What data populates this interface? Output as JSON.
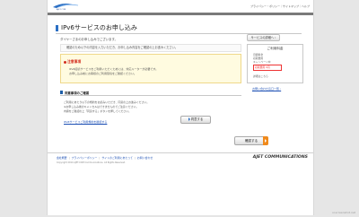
{
  "header": {
    "logo_text": "AJET.COM",
    "nav": "プライバシー・ポリシー｜サイトマップ｜ヘルプ"
  },
  "main": {
    "title": "IPv6サービスのお申し込み",
    "lead": "ダイヤーさまのお申し込みでございます。",
    "notice": "確認のため以下の内容を入力いただき、お申し込み内容をご確認の上お進みください。",
    "close_button": "サービスの詳細へ ›",
    "warning": {
      "title": "注意事項",
      "line1": "IPv6接続サービスをご利用いただくためには、対応ルーターが必要です。",
      "line2": "お申し込み前にお客様のご利用環境をご確認ください。"
    },
    "section_title": "同意事項のご確認",
    "consent_lines": [
      "ご利用にあたり以下の規約をお読みいただき、同意の上お進みください。",
      "※お申し込み後のキャンセルはできませんのでご注意ください。",
      "内容をご確認の上「同意する」ボタンを押してください。"
    ],
    "terms_link": "IPv6サービスご利用規約を確認する",
    "agree_button": "同意する",
    "confirm_button": "確認する"
  },
  "contact": {
    "title": "ご利用料金",
    "line1": "月額料金",
    "line2": "初期費用",
    "line3": "キャンペーン中",
    "highlight": "初期費用 0円",
    "line4": "詳細はこちら"
  },
  "side_link": "お問い合わせ窓口一覧 ›",
  "footer": {
    "links": [
      "会社概要",
      "プライバシーポリシー",
      "サイトのご利用にあたって",
      "お問い合わせ"
    ],
    "brand": "AJET COMMUNICATIONS",
    "copyright": "Copyright 2014 AJET.COM Communications. All Rights Reserved."
  },
  "watermark": "ui-screenshot.net"
}
